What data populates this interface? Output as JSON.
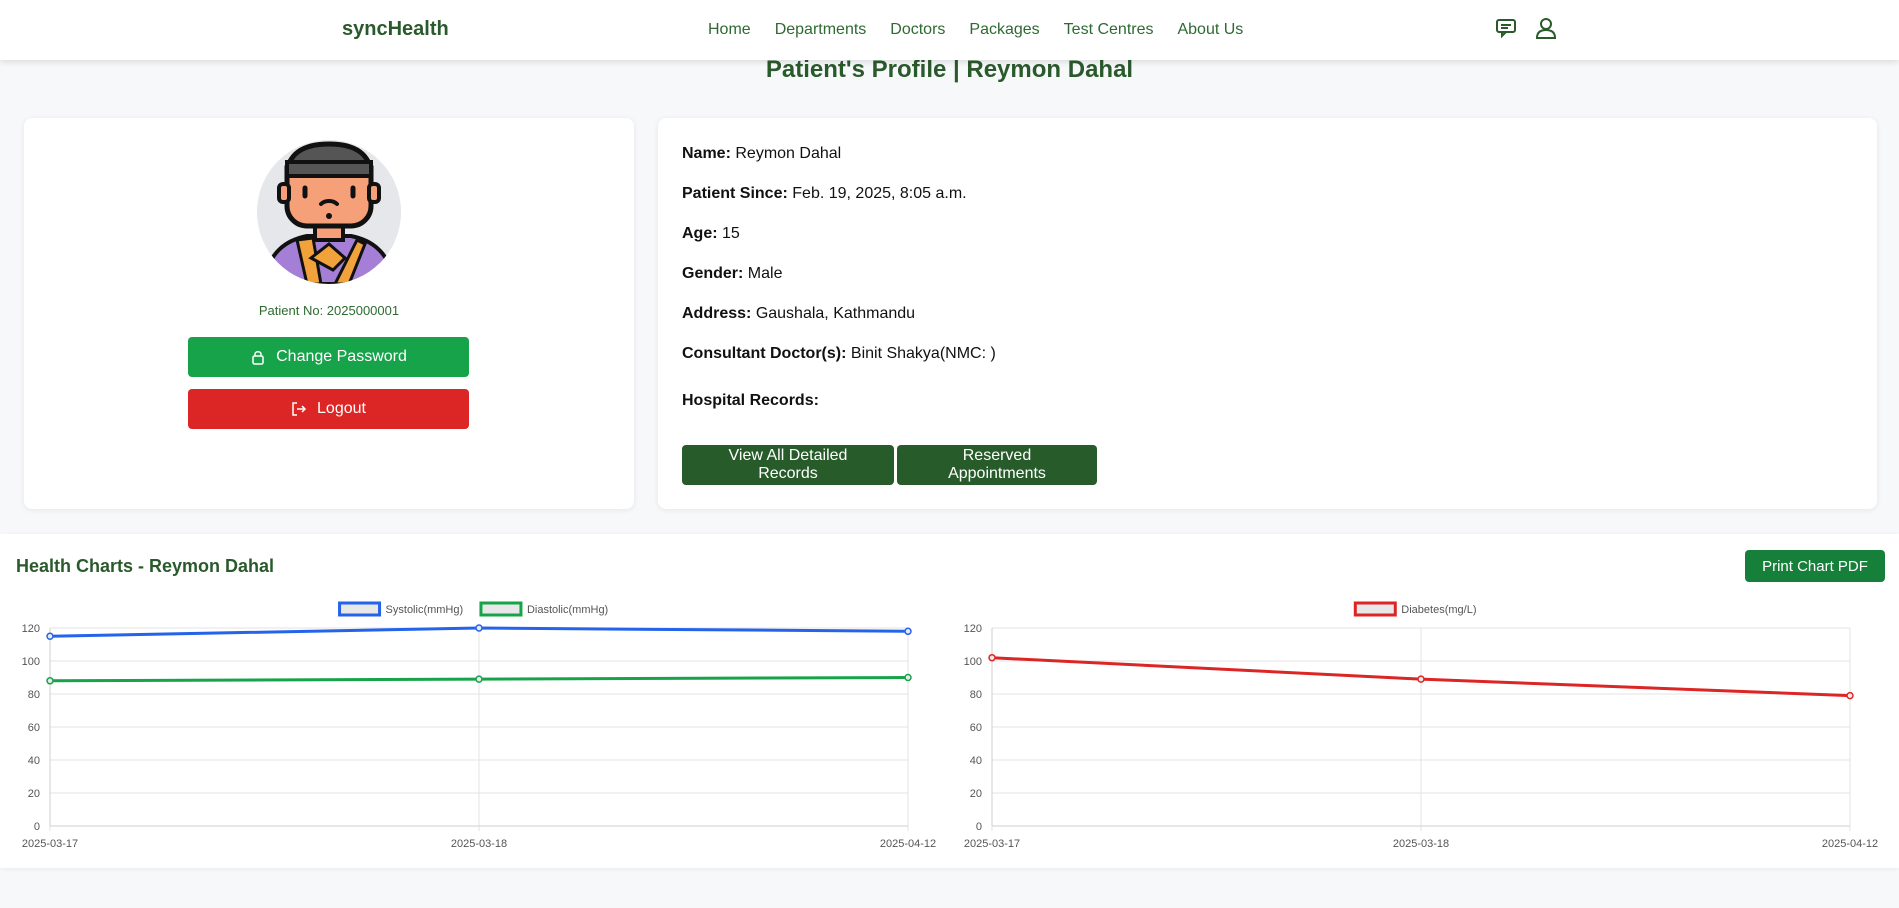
{
  "nav": {
    "brand": "syncHealth",
    "links": [
      "Home",
      "Departments",
      "Doctors",
      "Packages",
      "Test Centres",
      "About Us"
    ],
    "icons": [
      "chat-icon",
      "user-icon"
    ]
  },
  "page_title": "Patient's Profile | Reymon Dahal",
  "profile": {
    "patient_no": "Patient No: 2025000001",
    "change_password": "Change Password",
    "logout": "Logout"
  },
  "details": {
    "name_label": "Name:",
    "name_value": "Reymon Dahal",
    "since_label": "Patient Since:",
    "since_value": "Feb. 19, 2025, 8:05 a.m.",
    "age_label": "Age:",
    "age_value": "15",
    "gender_label": "Gender:",
    "gender_value": "Male",
    "address_label": "Address:",
    "address_value": "Gaushala, Kathmandu",
    "consultant_label": "Consultant Doctor(s):",
    "consultant_value": "Binit Shakya(NMC: )",
    "records_label": "Hospital Records:",
    "view_records": "View All Detailed Records",
    "reserved": "Reserved Appointments"
  },
  "charts": {
    "title": "Health Charts - Reymon Dahal",
    "print": "Print Chart PDF"
  },
  "colors": {
    "brand_green": "#2a5a2c",
    "systolic": "#2563eb",
    "diastolic": "#16a34a",
    "diabetes": "#dc2626"
  },
  "chart_data": [
    {
      "type": "line",
      "categories": [
        "2025-03-17",
        "2025-03-18",
        "2025-04-12"
      ],
      "series": [
        {
          "name": "Systolic(mmHg)",
          "values": [
            115,
            120,
            118
          ],
          "color": "#2563eb"
        },
        {
          "name": "Diastolic(mmHg)",
          "values": [
            88,
            89,
            90
          ],
          "color": "#16a34a"
        }
      ],
      "ylim": [
        0,
        120
      ],
      "yticks": [
        0,
        20,
        40,
        60,
        80,
        100,
        120
      ],
      "legend": "top",
      "grid": true
    },
    {
      "type": "line",
      "categories": [
        "2025-03-17",
        "2025-03-18",
        "2025-04-12"
      ],
      "series": [
        {
          "name": "Diabetes(mg/L)",
          "values": [
            102,
            89,
            79
          ],
          "color": "#dc2626"
        }
      ],
      "ylim": [
        0,
        120
      ],
      "yticks": [
        0,
        20,
        40,
        60,
        80,
        100,
        120
      ],
      "legend": "top",
      "grid": true
    }
  ]
}
